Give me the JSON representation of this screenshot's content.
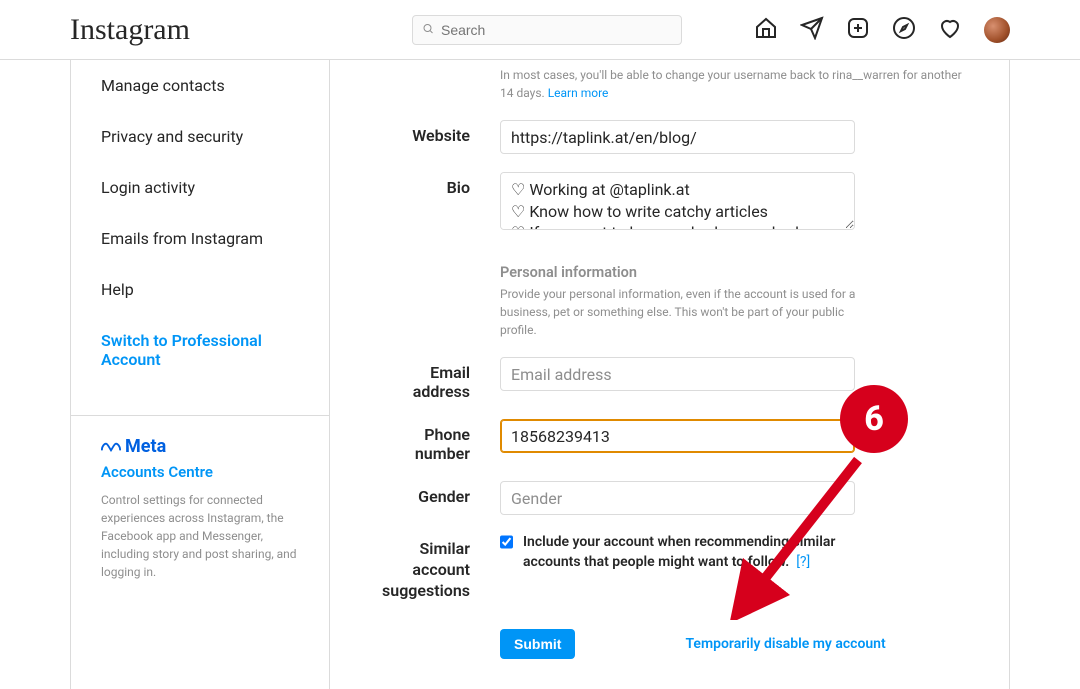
{
  "topnav": {
    "logo": "Instagram",
    "search_placeholder": "Search"
  },
  "sidebar": {
    "items": [
      "Manage contacts",
      "Privacy and security",
      "Login activity",
      "Emails from Instagram",
      "Help"
    ],
    "pro_link": "Switch to Professional Account",
    "meta_label": "Meta",
    "accounts_centre": "Accounts Centre",
    "meta_desc": "Control settings for connected experiences across Instagram, the Facebook app and Messenger, including story and post sharing, and logging in."
  },
  "form": {
    "username_hint_1": "In most cases, you'll be able to change your username back to rina__warren for another 14 days. ",
    "username_hint_link": "Learn more",
    "labels": {
      "website": "Website",
      "bio": "Bio",
      "email": "Email address",
      "phone": "Phone number",
      "gender": "Gender",
      "similar": "Similar account suggestions"
    },
    "website_value": "https://taplink.at/en/blog/",
    "bio_value": "♡ Working at @taplink.at\n♡ Know how to write catchy articles\n♡ If you want to be somebody, somebody",
    "personal_head": "Personal information",
    "personal_desc": "Provide your personal information, even if the account is used for a business, pet or something else. This won't be part of your public profile.",
    "email_placeholder": "Email address",
    "email_value": "",
    "phone_value": "18568239413",
    "gender_placeholder": "Gender",
    "similar_text": "Include your account when recommending similar accounts that people might want to follow.",
    "similar_help": "[?]",
    "submit": "Submit",
    "disable": "Temporarily disable my account"
  },
  "annotation": {
    "badge": "6"
  }
}
